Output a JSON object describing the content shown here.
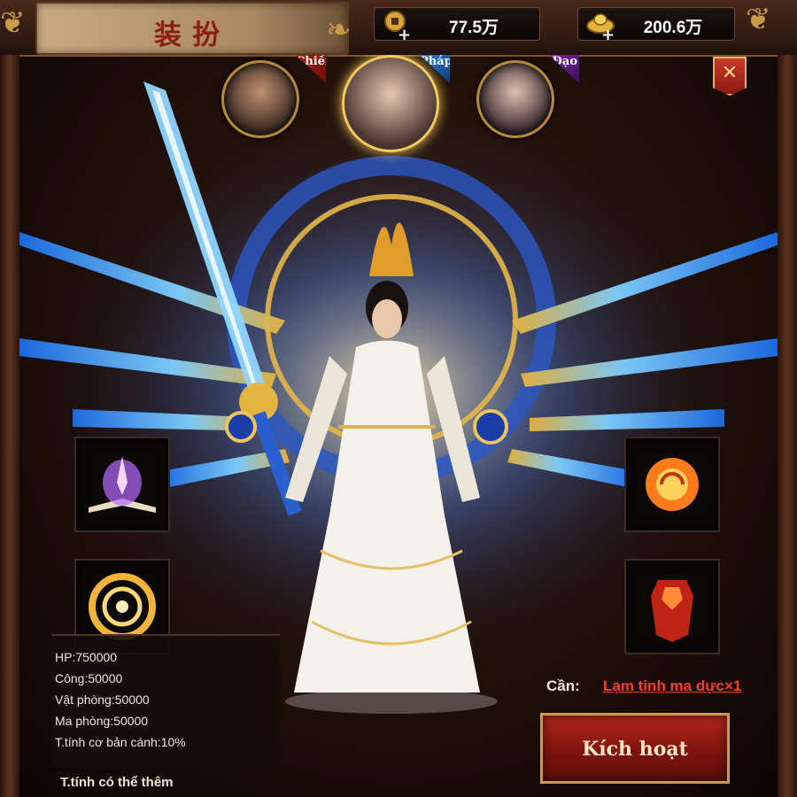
{
  "header": {
    "title": "装扮",
    "currency_coin": {
      "icon": "coin-icon",
      "value": "77.5万"
    },
    "currency_ingot": {
      "icon": "gold-ingot-icon",
      "value": "200.6万"
    }
  },
  "characters": [
    {
      "class_label": "Chiến",
      "tag_color": "#b21c14",
      "selected": false
    },
    {
      "class_label": "Pháp",
      "tag_color": "#2a7fd4",
      "selected": true
    },
    {
      "class_label": "Đạo",
      "tag_color": "#7c2aa8",
      "selected": false
    }
  ],
  "close_icon": "close-icon",
  "slots": {
    "left": [
      {
        "icon": "magic-book-icon"
      },
      {
        "icon": "golden-vortex-icon"
      }
    ],
    "right": [
      {
        "icon": "fire-orb-icon"
      },
      {
        "icon": "red-armor-icon"
      }
    ]
  },
  "stats": {
    "hp": "HP:750000",
    "attack": "Công:50000",
    "phys_def": "Vật phòng:50000",
    "mag_def": "Ma phòng:50000",
    "wing_attr": "T.tính cơ bản cánh:10%"
  },
  "extra_title": "T.tính có thể thêm",
  "requirement": {
    "label": "Cần:",
    "item": "Lạm tinh ma dực×1"
  },
  "activate_button": "Kích hoạt"
}
